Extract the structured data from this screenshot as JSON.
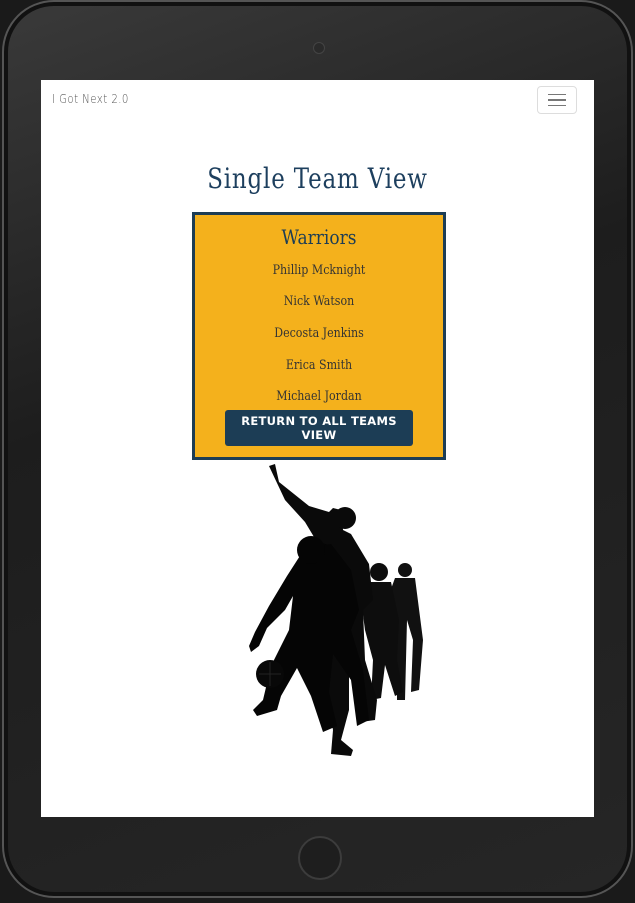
{
  "navbar": {
    "brand": "I Got Next 2.0",
    "toggler_icon": "hamburger-menu-icon"
  },
  "page": {
    "title": "Single Team View"
  },
  "team": {
    "name": "Warriors",
    "players": [
      "Phillip Mcknight",
      "Nick Watson",
      "Decosta Jenkins",
      "Erica Smith",
      "Michael Jordan"
    ],
    "return_label": "RETURN TO ALL TEAMS VIEW"
  },
  "colors": {
    "accent": "#f4b11c",
    "primary": "#1c3d55"
  },
  "image": {
    "icon": "basketball-players-silhouette"
  }
}
